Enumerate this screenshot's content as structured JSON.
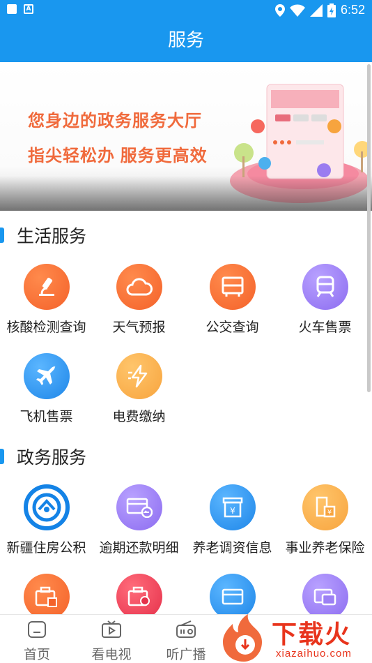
{
  "status_bar": {
    "time": "6:52"
  },
  "header": {
    "title": "服务"
  },
  "banner": {
    "line1": "您身边的政务服务大厅",
    "line2": "指尖轻松办  服务更高效"
  },
  "sections": [
    {
      "title": "生活服务",
      "items": [
        {
          "label": "核酸检测查询",
          "icon": "microscope-icon",
          "color": "#f4622a"
        },
        {
          "label": "天气预报",
          "icon": "cloud-icon",
          "color": "#f4622a"
        },
        {
          "label": "公交查询",
          "icon": "bus-icon",
          "color": "#f4622a"
        },
        {
          "label": "火车售票",
          "icon": "train-icon",
          "color": "#8c6cf0"
        },
        {
          "label": "飞机售票",
          "icon": "airplane-icon",
          "color": "#1e86e8"
        },
        {
          "label": "电费缴纳",
          "icon": "lightning-icon",
          "color": "#f7a43e"
        }
      ]
    },
    {
      "title": "政务服务",
      "items": [
        {
          "label": "新疆住房公积",
          "icon": "housing-fund-logo-icon",
          "color": "#1483e6"
        },
        {
          "label": "逾期还款明细",
          "icon": "card-return-icon",
          "color": "#8c6cf0"
        },
        {
          "label": "养老调资信息",
          "icon": "yuan-box-icon",
          "color": "#1e86e8"
        },
        {
          "label": "事业养老保险",
          "icon": "building-yuan-icon",
          "color": "#f7a43e"
        },
        {
          "label": "",
          "icon": "wallet-yuan-icon",
          "color": "#f4622a"
        },
        {
          "label": "",
          "icon": "wallet-forbidden-icon",
          "color": "#e5304a"
        },
        {
          "label": "",
          "icon": "card-icon",
          "color": "#1e86e8"
        },
        {
          "label": "",
          "icon": "cards-icon",
          "color": "#8c6cf0"
        }
      ]
    }
  ],
  "bottom_nav": [
    {
      "label": "首页",
      "icon": "home-icon"
    },
    {
      "label": "看电视",
      "icon": "tv-icon"
    },
    {
      "label": "听广播",
      "icon": "radio-icon"
    }
  ],
  "watermark": {
    "text": "下载火",
    "url": "xiazaihuo.com"
  }
}
